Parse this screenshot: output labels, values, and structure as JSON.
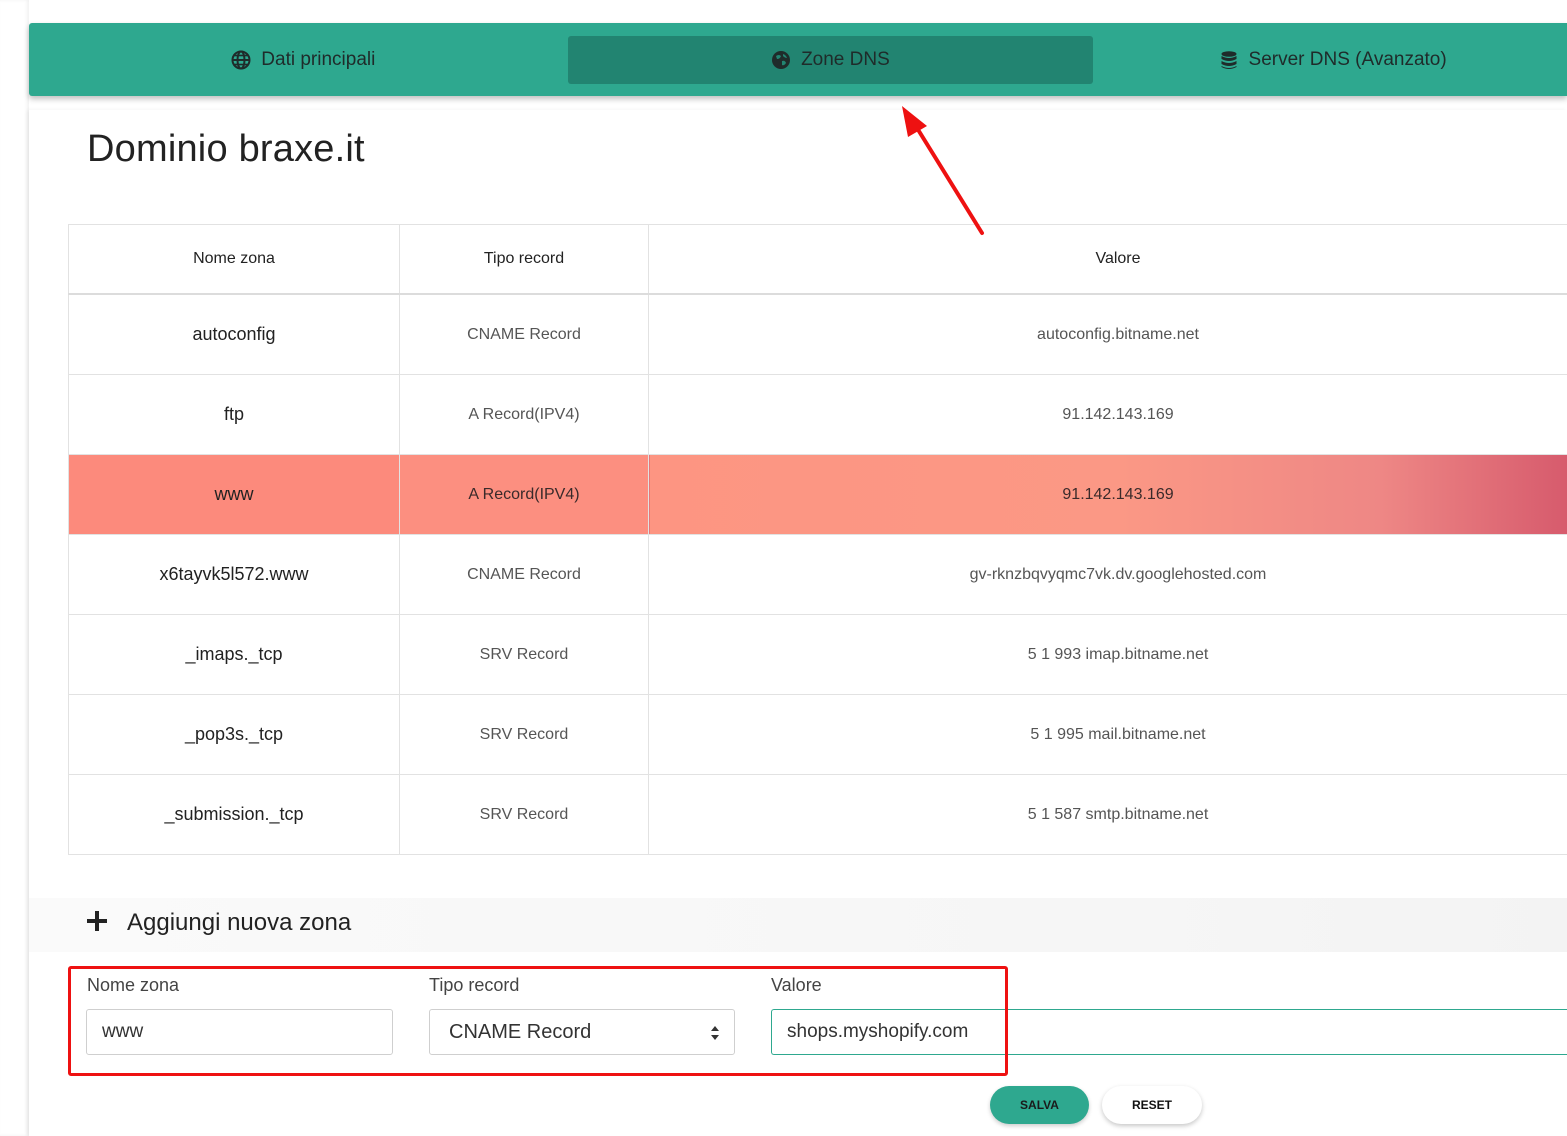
{
  "nav": {
    "tabs": [
      {
        "label": "Dati principali",
        "icon": "globe-icon"
      },
      {
        "label": "Zone DNS",
        "icon": "globe-americas-icon",
        "active": true
      },
      {
        "label": "Server DNS (Avanzato)",
        "icon": "database-icon"
      }
    ]
  },
  "page": {
    "title_prefix": "Dominio",
    "domain": "braxe.it"
  },
  "table": {
    "headers": [
      "Nome zona",
      "Tipo record",
      "Valore"
    ],
    "rows": [
      {
        "name": "autoconfig",
        "type": "CNAME Record",
        "value": "autoconfig.bitname.net"
      },
      {
        "name": "ftp",
        "type": "A Record(IPV4)",
        "value": "91.142.143.169"
      },
      {
        "name": "www",
        "type": "A Record(IPV4)",
        "value": "91.142.143.169",
        "highlighted": true
      },
      {
        "name": "x6tayvk5l572.www",
        "type": "CNAME Record",
        "value": "gv-rknzbqvyqmc7vk.dv.googlehosted.com"
      },
      {
        "name": "_imaps._tcp",
        "type": "SRV Record",
        "value": "5 1 993 imap.bitname.net"
      },
      {
        "name": "_pop3s._tcp",
        "type": "SRV Record",
        "value": "5 1 995 mail.bitname.net"
      },
      {
        "name": "_submission._tcp",
        "type": "SRV Record",
        "value": "5 1 587 smtp.bitname.net"
      }
    ]
  },
  "add_zone": {
    "label": "Aggiungi nuova zona",
    "fields": {
      "name_label": "Nome zona",
      "name_value": "www",
      "type_label": "Tipo record",
      "type_value": "CNAME Record",
      "value_label": "Valore",
      "value_value": "shops.myshopify.com"
    },
    "save_label": "SALVA",
    "reset_label": "RESET"
  },
  "colors": {
    "accent": "#2ea88f",
    "accent_active": "#228471",
    "highlight_row": "#fc8a7c",
    "annotation_red": "#ee1111"
  }
}
